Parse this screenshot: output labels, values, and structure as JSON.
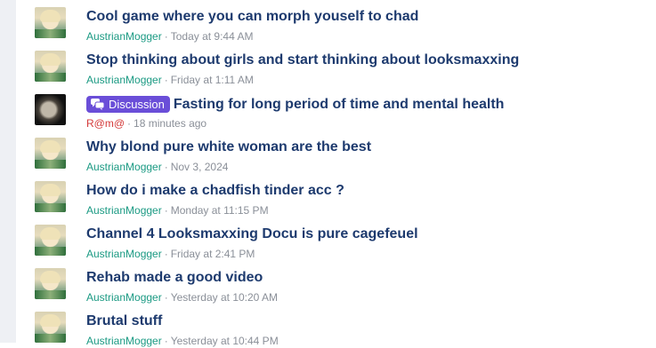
{
  "threads": [
    {
      "title": "Cool game where you can morph youself to chad",
      "author": "AustrianMogger",
      "time": "Today at 9:44 AM",
      "avatar": "anime-blonde-avatar",
      "author_color": "#1b9a83"
    },
    {
      "title": "Stop thinking about girls and start thinking about looksmaxxing",
      "author": "AustrianMogger",
      "time": "Friday at 1:11 AM",
      "avatar": "anime-blonde-avatar",
      "author_color": "#1b9a83"
    },
    {
      "title": "Fasting for long period of time and mental health",
      "label": "Discussion",
      "label_color": "#6a4ed8",
      "author": "R@m@",
      "time": "18 minutes ago",
      "avatar": "skull-avatar",
      "author_color": "#d43a3a"
    },
    {
      "title": "Why blond pure white woman are the best",
      "author": "AustrianMogger",
      "time": "Nov 3, 2024",
      "avatar": "anime-blonde-avatar",
      "author_color": "#1b9a83"
    },
    {
      "title": "How do i make a chadfish tinder acc ?",
      "author": "AustrianMogger",
      "time": "Monday at 11:15 PM",
      "avatar": "anime-blonde-avatar",
      "author_color": "#1b9a83"
    },
    {
      "title": "Channel 4 Looksmaxxing Docu is pure cagefeuel",
      "author": "AustrianMogger",
      "time": "Friday at 2:41 PM",
      "avatar": "anime-blonde-avatar",
      "author_color": "#1b9a83"
    },
    {
      "title": "Rehab made a good video",
      "author": "AustrianMogger",
      "time": "Yesterday at 10:20 AM",
      "avatar": "anime-blonde-avatar",
      "author_color": "#1b9a83"
    },
    {
      "title": "Brutal stuff",
      "author": "AustrianMogger",
      "time": "Yesterday at 10:44 PM",
      "avatar": "anime-blonde-avatar",
      "author_color": "#1b9a83"
    }
  ],
  "meta_separator": "·"
}
